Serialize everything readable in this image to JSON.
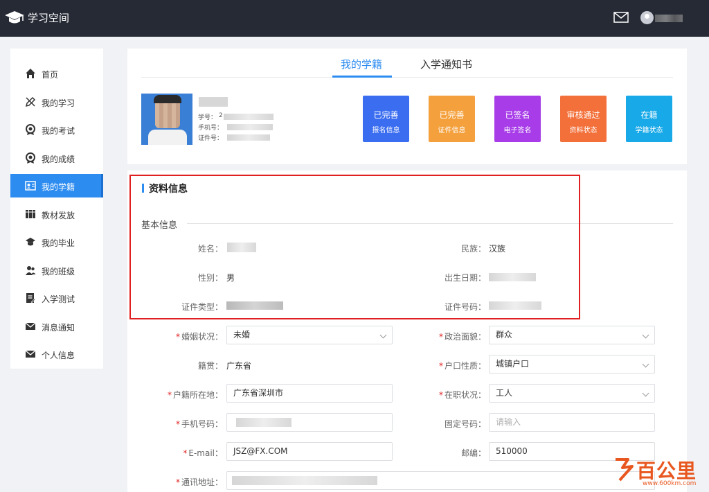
{
  "app": {
    "title": "学习空间"
  },
  "sidebar": {
    "items": [
      {
        "label": "首页",
        "icon": "home-icon"
      },
      {
        "label": "我的学习",
        "icon": "pencil-ruler-icon"
      },
      {
        "label": "我的考试",
        "icon": "medal-icon"
      },
      {
        "label": "我的成绩",
        "icon": "medal-icon"
      },
      {
        "label": "我的学籍",
        "icon": "id-card-icon",
        "active": true
      },
      {
        "label": "教材发放",
        "icon": "books-icon"
      },
      {
        "label": "我的毕业",
        "icon": "graduation-cap-icon"
      },
      {
        "label": "我的班级",
        "icon": "people-icon"
      },
      {
        "label": "入学测试",
        "icon": "clipboard-icon"
      },
      {
        "label": "消息通知",
        "icon": "mail-icon"
      },
      {
        "label": "个人信息",
        "icon": "mail-icon"
      }
    ]
  },
  "tabs": [
    {
      "label": "我的学籍",
      "active": true
    },
    {
      "label": "入学通知书",
      "active": false
    }
  ],
  "profile": {
    "student_no_label": "学号：",
    "student_no_prefix": "2",
    "phone_label": "手机号：",
    "id_label": "证件号："
  },
  "statuses": [
    {
      "line1": "已完善",
      "line2": "报名信息",
      "color": "#3a6df0"
    },
    {
      "line1": "已完善",
      "line2": "证件信息",
      "color": "#f4a03c"
    },
    {
      "line1": "已签名",
      "line2": "电子签名",
      "color": "#a73ce8"
    },
    {
      "line1": "审核通过",
      "line2": "资料状态",
      "color": "#f3703a"
    },
    {
      "line1": "在籍",
      "line2": "学籍状态",
      "color": "#18a9e8"
    }
  ],
  "section": {
    "title": "资料信息",
    "subtitle": "基本信息"
  },
  "basic": {
    "name_label": "姓名：",
    "ethnicity_label": "民族：",
    "ethnicity_value": "汉族",
    "gender_label": "性别：",
    "gender_value": "男",
    "birth_label": "出生日期：",
    "id_type_label": "证件类型：",
    "id_no_label": "证件号码："
  },
  "form": {
    "marital_label": "婚姻状况：",
    "marital_value": "未婚",
    "political_label": "政治面貌：",
    "political_value": "群众",
    "native_label": "籍贯：",
    "native_value": "广东省",
    "hukou_type_label": "户口性质：",
    "hukou_type_value": "城镇户口",
    "hukou_loc_label": "户籍所在地：",
    "hukou_loc_value": "广东省深圳市",
    "job_label": "在职状况：",
    "job_value": "工人",
    "phone_label": "手机号码：",
    "landline_label": "固定号码：",
    "landline_placeholder": "请输入",
    "email_label": "E-mail：",
    "email_value": "JSZ@FX.COM",
    "postcode_label": "邮编：",
    "postcode_value": "510000",
    "address_label": "通讯地址："
  },
  "watermark": {
    "text": "百公里",
    "url": "www.600km.com"
  }
}
